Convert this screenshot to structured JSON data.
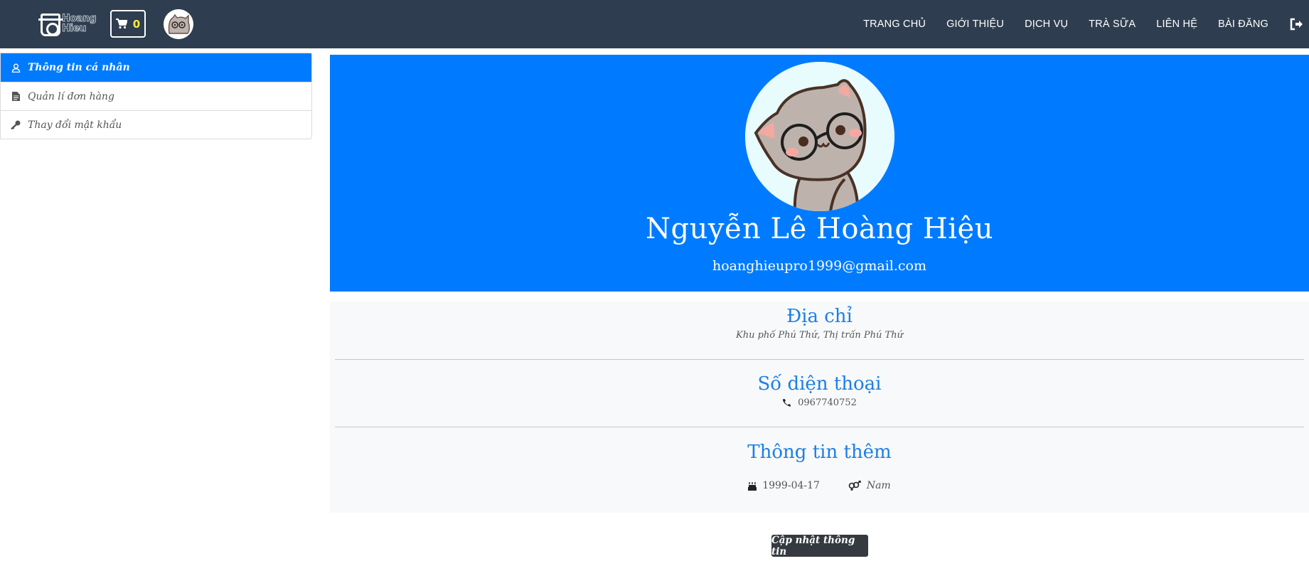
{
  "navbar": {
    "logo_text": "Hoang Hieu",
    "cart_count": "0",
    "links": [
      "TRANG CHỦ",
      "GIỚI THIỆU",
      "DỊCH VỤ",
      "TRÀ SỮA",
      "LIÊN HỆ",
      "BÀI ĐĂNG"
    ]
  },
  "sidebar": {
    "items": [
      {
        "label": "Thông tin cá nhân",
        "icon": "user-icon"
      },
      {
        "label": "Quản lí đơn hàng",
        "icon": "file-icon"
      },
      {
        "label": "Thay đổi mật khẩu",
        "icon": "key-icon"
      }
    ]
  },
  "profile": {
    "name": "Nguyễn Lê Hoàng Hiệu",
    "email": "hoanghieupro1999@gmail.com"
  },
  "info": {
    "address_title": "Địa chỉ",
    "address_value": "Khu phố Phú Thứ, Thị trấn Phú Thứ",
    "phone_title": "Số diện thoại",
    "phone_value": "0967740752",
    "extra_title": "Thông tin thêm",
    "birthday": "1999-04-17",
    "gender": "Nam"
  },
  "actions": {
    "update_label": "Cập nhật thông tin"
  },
  "colors": {
    "navbar": "#2e3e50",
    "primary": "#007bff",
    "heading_blue": "#1b7fe6",
    "cart_count": "#ffeb3b",
    "button_dark": "#343a40"
  }
}
